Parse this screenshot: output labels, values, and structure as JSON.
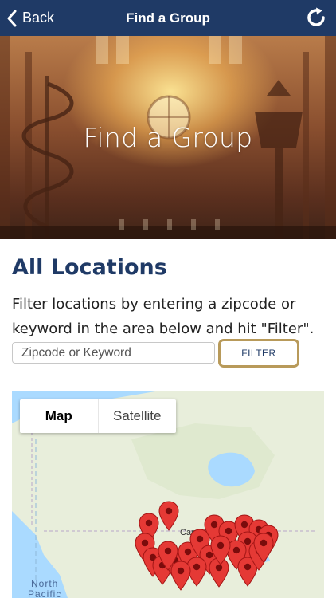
{
  "nav": {
    "back_label": "Back",
    "title": "Find a Group",
    "back_icon": "chevron-left-icon",
    "refresh_icon": "refresh-icon",
    "bar_color": "#1f3a66"
  },
  "hero": {
    "title": "Find a Group"
  },
  "locations": {
    "heading": "All Locations",
    "description": "Filter locations by entering a zipcode or keyword in the area below and hit \"Filter\".",
    "search_placeholder": "Zipcode or Keyword",
    "search_value": "",
    "filter_label": "FILTER",
    "filter_border_color": "#b89a5a"
  },
  "map": {
    "toggle": {
      "map_label": "Map",
      "satellite_label": "Satellite",
      "selected": "Map"
    },
    "country_label": "Canada",
    "ocean_label_line1": "North",
    "ocean_label_line2": "Pacific",
    "marker_icon": "map-pin-icon",
    "marker_color": "#e53935"
  }
}
